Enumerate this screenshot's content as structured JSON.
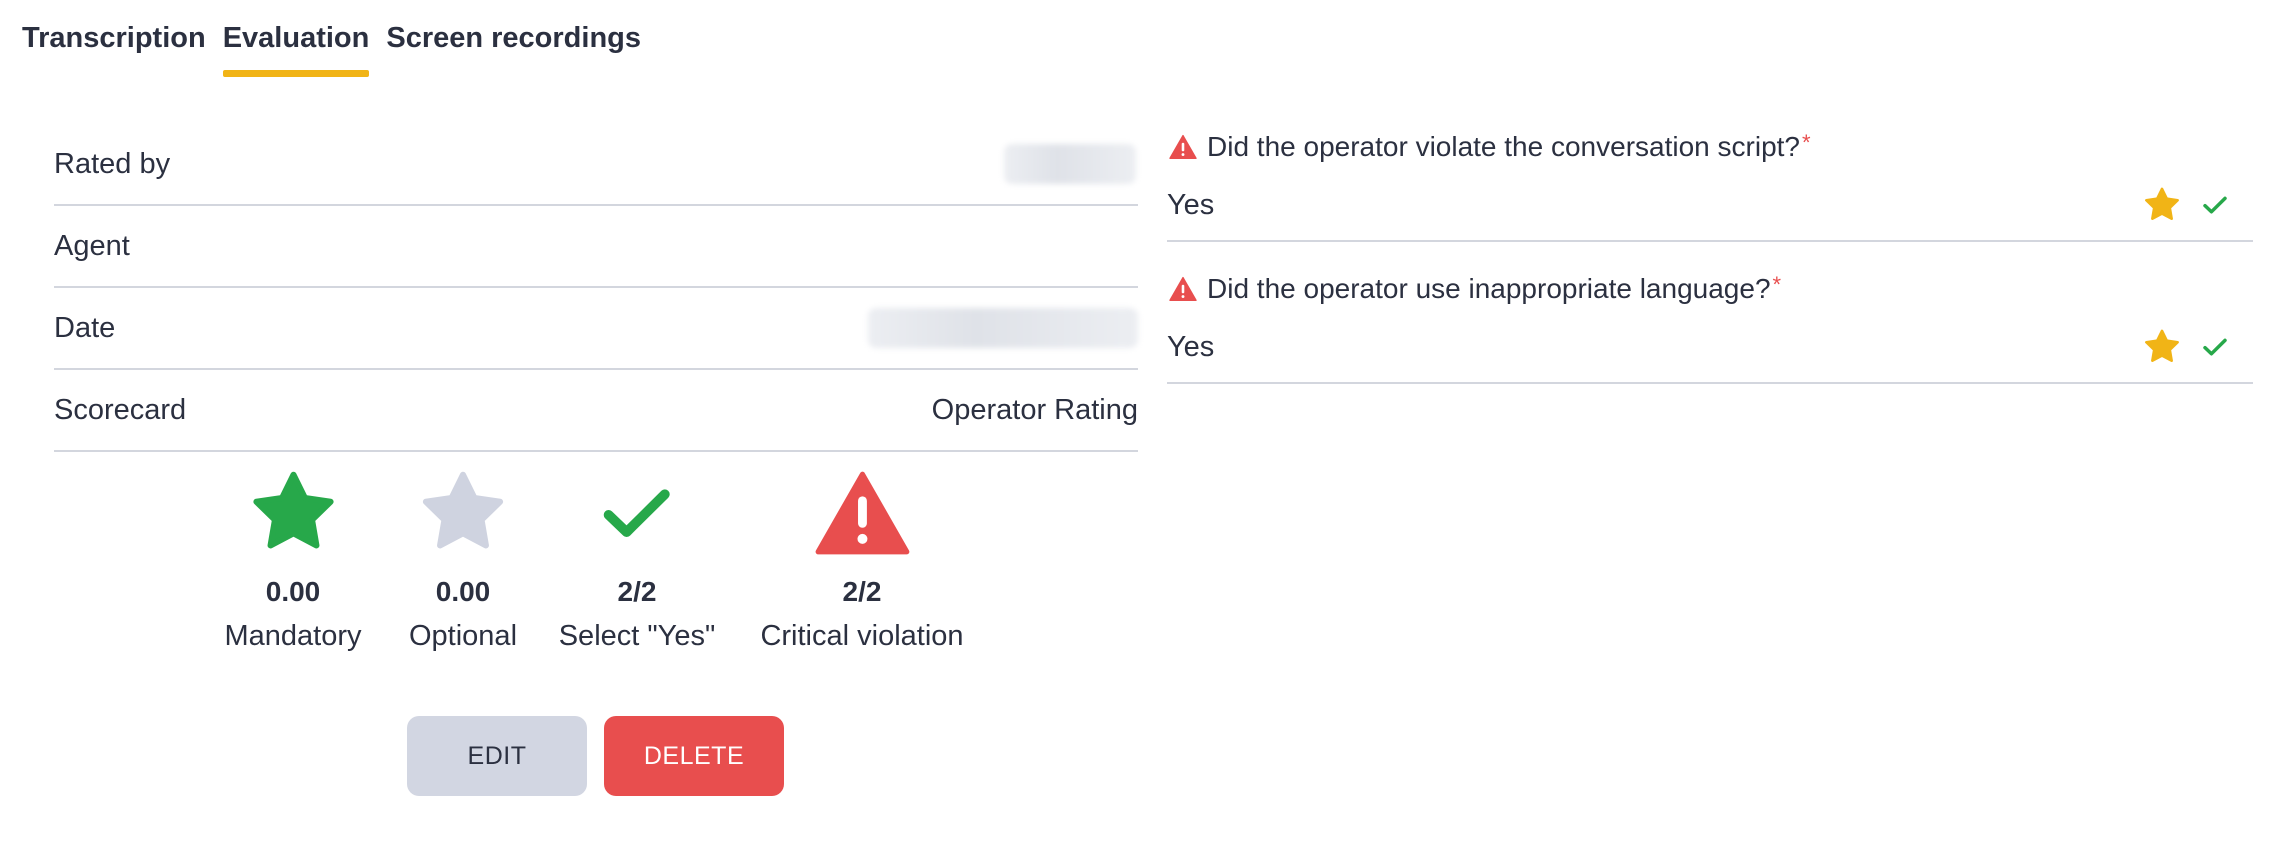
{
  "tabs": [
    {
      "label": "Transcription",
      "active": false
    },
    {
      "label": "Evaluation",
      "active": true
    },
    {
      "label": "Screen recordings",
      "active": false
    }
  ],
  "info": {
    "rated_by_label": "Rated by",
    "agent_label": "Agent",
    "date_label": "Date",
    "scorecard_label": "Scorecard",
    "scorecard_value": "Operator Rating"
  },
  "stats": [
    {
      "icon": "green-star-icon",
      "value": "0.00",
      "label": "Mandatory"
    },
    {
      "icon": "gray-star-icon",
      "value": "0.00",
      "label": "Optional"
    },
    {
      "icon": "green-check-icon",
      "value": "2/2",
      "label": "Select \"Yes\""
    },
    {
      "icon": "red-warning-icon",
      "value": "2/2",
      "label": "Critical violation"
    }
  ],
  "buttons": {
    "edit": "EDIT",
    "delete": "DELETE"
  },
  "questions": [
    {
      "title": "Did the operator violate the conversation script?",
      "required": "*",
      "answer": "Yes"
    },
    {
      "title": "Did the operator use inappropriate language?",
      "required": "*",
      "answer": "Yes"
    }
  ],
  "colors": {
    "accent_tab": "#f1b416",
    "green": "#27a84a",
    "gray_star": "#cfd3e0",
    "red": "#e84e4e",
    "gold_star": "#f1b416"
  }
}
